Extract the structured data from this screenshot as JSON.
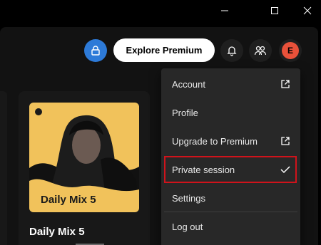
{
  "window_controls": {
    "minimize": "minimize-icon",
    "maximize": "maximize-icon",
    "close": "close-icon"
  },
  "topbar": {
    "explore_label": "Explore Premium",
    "avatar_initial": "E"
  },
  "card": {
    "cover_title": "Daily Mix 5",
    "title": "Daily Mix 5"
  },
  "menu": {
    "items": [
      {
        "label": "Account",
        "icon": "external-link-icon"
      },
      {
        "label": "Profile"
      },
      {
        "label": "Upgrade to Premium",
        "icon": "external-link-icon"
      },
      {
        "label": "Private session",
        "icon": "check-icon",
        "checked": true
      },
      {
        "label": "Settings"
      },
      {
        "label": "Log out"
      }
    ]
  },
  "colors": {
    "accent_blue": "#2d7ad8",
    "avatar": "#e8513a",
    "cover": "#f1c25b",
    "highlight": "#d0131b"
  }
}
